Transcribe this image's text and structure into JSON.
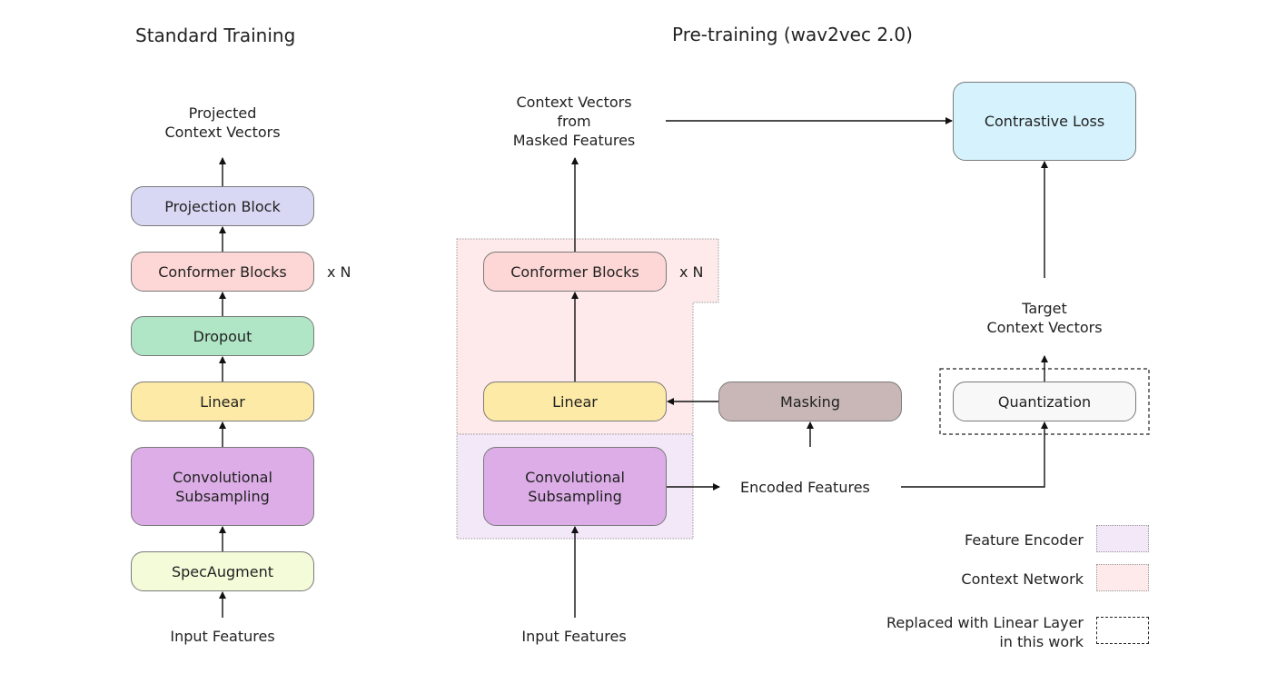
{
  "titles": {
    "standard": "Standard Training",
    "pretraining": "Pre-training (wav2vec 2.0)"
  },
  "standard": {
    "output_label_line1": "Projected",
    "output_label_line2": "Context Vectors",
    "blocks": [
      {
        "label": "Projection Block",
        "color": "#d9d8f4"
      },
      {
        "label": "Conformer Blocks",
        "color": "#fdd6d6"
      },
      {
        "label": "Dropout",
        "color": "#b0e6c6"
      },
      {
        "label": "Linear",
        "color": "#fdeaa6"
      },
      {
        "label_line1": "Convolutional",
        "label_line2": "Subsampling",
        "color": "#dcade6"
      },
      {
        "label": "SpecAugment",
        "color": "#f4fbd8"
      }
    ],
    "repeat_label": "x N",
    "input_label": "Input Features"
  },
  "pretraining": {
    "output_label_line1": "Context Vectors",
    "output_label_line2": "from",
    "output_label_line3": "Masked Features",
    "conformer": {
      "label": "Conformer Blocks",
      "color": "#fdd6d6"
    },
    "repeat_label": "x N",
    "linear": {
      "label": "Linear",
      "color": "#fdeaa6"
    },
    "conv": {
      "label_line1": "Convolutional",
      "label_line2": "Subsampling",
      "color": "#dcade6"
    },
    "masking": {
      "label": "Masking",
      "color": "#c8b7b6"
    },
    "encoded_label": "Encoded Features",
    "input_label": "Input Features",
    "contrastive": {
      "label": "Contrastive Loss",
      "color": "#d6f3fd"
    },
    "target_label_line1": "Target",
    "target_label_line2": "Context Vectors",
    "quantization": {
      "label": "Quantization",
      "color": "#f8f8f8"
    },
    "regions": {
      "context_network_color": "#feeaea",
      "feature_encoder_color": "#f3e8f8"
    }
  },
  "legend": [
    {
      "label": "Feature Encoder",
      "kind": "feature-encoder",
      "color": "#f3e8f8"
    },
    {
      "label": "Context Network",
      "kind": "context-network",
      "color": "#feeaea"
    },
    {
      "label_line1": "Replaced with Linear Layer",
      "label_line2": "in this work",
      "kind": "dashed-outline",
      "color": "#ffffff"
    }
  ]
}
